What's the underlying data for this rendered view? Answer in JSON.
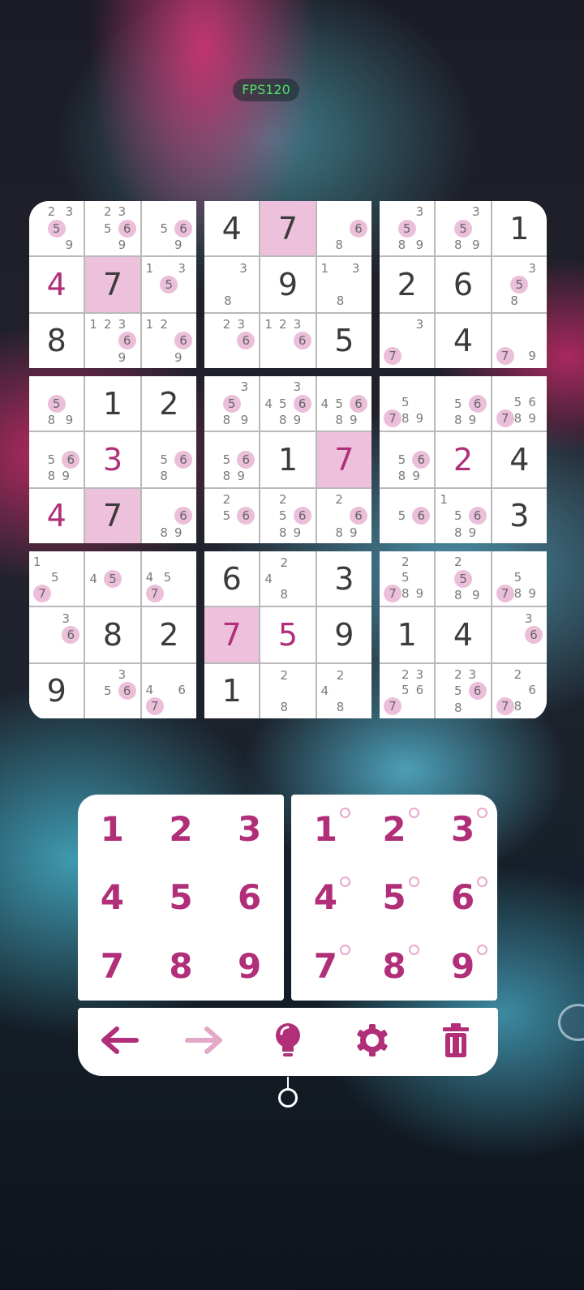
{
  "fps_label": "FPS120",
  "colors": {
    "accent": "#b12f79",
    "selected": "#edc0dc",
    "note_highlight": "#ebbfd9"
  },
  "board": [
    [
      {
        "notes": [
          "2",
          "3",
          "5",
          "9"
        ],
        "hl": [
          "5"
        ]
      },
      {
        "notes": [
          "2",
          "3",
          "5",
          "6",
          "9"
        ],
        "hl": [
          "6"
        ]
      },
      {
        "notes": [
          "5",
          "6",
          "9"
        ],
        "hl": [
          "6"
        ]
      },
      {
        "value": "4",
        "user": true
      },
      {
        "value": "7",
        "user": false,
        "selected": true
      },
      {
        "notes": [
          "1",
          "3",
          "5"
        ],
        "hl": [
          "5"
        ]
      },
      {
        "value": "8"
      },
      {
        "notes": [
          "1",
          "2",
          "3",
          "6",
          "9"
        ],
        "hl": [
          "6"
        ]
      },
      {
        "notes": [
          "1",
          "2",
          "6",
          "9"
        ],
        "hl": [
          "6"
        ]
      }
    ],
    [
      {
        "value": "4"
      },
      {
        "value": "7",
        "selected": true
      },
      {
        "notes": [
          "6",
          "8"
        ],
        "hl": [
          "6"
        ]
      },
      {
        "notes": [
          "3",
          "8"
        ]
      },
      {
        "value": "9"
      },
      {
        "notes": [
          "1",
          "3",
          "8"
        ]
      },
      {
        "notes": [
          "2",
          "3",
          "6"
        ],
        "hl": [
          "6"
        ]
      },
      {
        "notes": [
          "1",
          "2",
          "3",
          "6"
        ],
        "hl": [
          "6"
        ]
      },
      {
        "value": "5"
      }
    ],
    [
      {
        "notes": [
          "3",
          "5",
          "8",
          "9"
        ],
        "hl": [
          "5"
        ]
      },
      {
        "notes": [
          "3",
          "5",
          "8",
          "9"
        ],
        "hl": [
          "5"
        ]
      },
      {
        "value": "1"
      },
      {
        "value": "2"
      },
      {
        "value": "6"
      },
      {
        "notes": [
          "3",
          "5",
          "8"
        ],
        "hl": [
          "5"
        ]
      },
      {
        "notes": [
          "3",
          "7"
        ],
        "hl": [
          "7"
        ]
      },
      {
        "value": "4"
      },
      {
        "notes": [
          "7",
          "9"
        ],
        "hl": [
          "7"
        ]
      }
    ],
    [
      {
        "notes": [
          "5",
          "8",
          "9"
        ],
        "hl": [
          "5"
        ]
      },
      {
        "value": "1"
      },
      {
        "value": "2"
      },
      {
        "notes": [
          "5",
          "6",
          "8",
          "9"
        ],
        "hl": [
          "6"
        ]
      },
      {
        "value": "3",
        "user": true
      },
      {
        "notes": [
          "5",
          "6",
          "8"
        ],
        "hl": [
          "6"
        ]
      },
      {
        "value": "4",
        "user": true
      },
      {
        "value": "7",
        "selected": true
      },
      {
        "notes": [
          "6",
          "8",
          "9"
        ],
        "hl": [
          "6"
        ]
      }
    ],
    [
      {
        "notes": [
          "3",
          "5",
          "8",
          "9"
        ],
        "hl": [
          "5"
        ]
      },
      {
        "notes": [
          "3",
          "4",
          "5",
          "6",
          "8",
          "9"
        ],
        "hl": [
          "6"
        ]
      },
      {
        "notes": [
          "4",
          "5",
          "6",
          "8",
          "9"
        ],
        "hl": [
          "6"
        ]
      },
      {
        "notes": [
          "5",
          "6",
          "8",
          "9"
        ],
        "hl": [
          "6"
        ]
      },
      {
        "value": "1"
      },
      {
        "value": "7",
        "user": true,
        "selected": true
      },
      {
        "notes": [
          "2",
          "5",
          "6"
        ],
        "hl": [
          "6"
        ]
      },
      {
        "notes": [
          "2",
          "5",
          "6",
          "8",
          "9"
        ],
        "hl": [
          "6"
        ]
      },
      {
        "notes": [
          "2",
          "6",
          "8",
          "9"
        ],
        "hl": [
          "6"
        ]
      }
    ],
    [
      {
        "notes": [
          "5",
          "7",
          "8",
          "9"
        ],
        "hl": [
          "7"
        ]
      },
      {
        "notes": [
          "5",
          "6",
          "8",
          "9"
        ],
        "hl": [
          "6"
        ]
      },
      {
        "notes": [
          "5",
          "6",
          "7",
          "8",
          "9"
        ],
        "hl": [
          "7"
        ]
      },
      {
        "notes": [
          "5",
          "6",
          "8",
          "9"
        ],
        "hl": [
          "6"
        ]
      },
      {
        "value": "2",
        "user": true
      },
      {
        "value": "4"
      },
      {
        "notes": [
          "5",
          "6"
        ],
        "hl": [
          "6"
        ]
      },
      {
        "notes": [
          "1",
          "5",
          "6",
          "8",
          "9"
        ],
        "hl": [
          "6"
        ]
      },
      {
        "value": "3"
      }
    ],
    [
      {
        "notes": [
          "1",
          "5",
          "7"
        ],
        "hl": [
          "7"
        ]
      },
      {
        "notes": [
          "4",
          "5"
        ],
        "hl": [
          "5"
        ]
      },
      {
        "notes": [
          "4",
          "5",
          "7"
        ],
        "hl": [
          "7"
        ]
      },
      {
        "notes": [
          "3",
          "6"
        ],
        "hl": [
          "6"
        ]
      },
      {
        "value": "8"
      },
      {
        "value": "2"
      },
      {
        "value": "9"
      },
      {
        "notes": [
          "3",
          "5",
          "6"
        ],
        "hl": [
          "6"
        ]
      },
      {
        "notes": [
          "4",
          "6",
          "7"
        ],
        "hl": [
          "7"
        ]
      }
    ],
    [
      {
        "value": "6"
      },
      {
        "notes": [
          "2",
          "4",
          "8"
        ]
      },
      {
        "value": "3"
      },
      {
        "value": "7",
        "user": true,
        "selected": true
      },
      {
        "value": "5",
        "user": true
      },
      {
        "value": "9"
      },
      {
        "value": "1"
      },
      {
        "notes": [
          "2",
          "8"
        ]
      },
      {
        "notes": [
          "2",
          "4",
          "8"
        ]
      }
    ],
    [
      {
        "notes": [
          "2",
          "5",
          "7",
          "8",
          "9"
        ],
        "hl": [
          "7"
        ]
      },
      {
        "notes": [
          "2",
          "5",
          "8",
          "9"
        ],
        "hl": [
          "5"
        ]
      },
      {
        "notes": [
          "5",
          "7",
          "8",
          "9"
        ],
        "hl": [
          "7"
        ]
      },
      {
        "value": "1"
      },
      {
        "value": "4"
      },
      {
        "notes": [
          "3",
          "6"
        ],
        "hl": [
          "6"
        ]
      },
      {
        "notes": [
          "2",
          "3",
          "5",
          "6",
          "7"
        ],
        "hl": [
          "7"
        ]
      },
      {
        "notes": [
          "2",
          "3",
          "5",
          "6",
          "8"
        ],
        "hl": [
          "6"
        ]
      },
      {
        "notes": [
          "2",
          "6",
          "7",
          "8"
        ],
        "hl": [
          "7"
        ]
      }
    ]
  ],
  "number_pad": [
    "1",
    "2",
    "3",
    "4",
    "5",
    "6",
    "7",
    "8",
    "9"
  ],
  "notes_pad": [
    "1",
    "2",
    "3",
    "4",
    "5",
    "6",
    "7",
    "8",
    "9"
  ],
  "toolbar": [
    {
      "name": "undo-button",
      "icon": "arrow-left-icon",
      "color": "#b12f79"
    },
    {
      "name": "redo-button",
      "icon": "arrow-right-icon",
      "color": "#e3a8c8"
    },
    {
      "name": "hint-button",
      "icon": "lightbulb-icon",
      "color": "#b12f79"
    },
    {
      "name": "settings-button",
      "icon": "gear-icon",
      "color": "#b12f79"
    },
    {
      "name": "delete-button",
      "icon": "trash-icon",
      "color": "#b12f79"
    }
  ]
}
